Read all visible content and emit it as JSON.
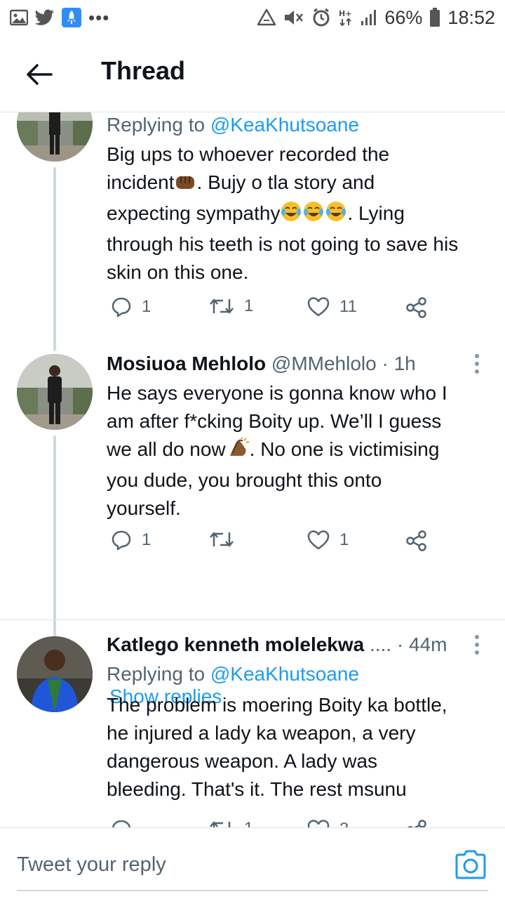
{
  "status_bar": {
    "battery": "66%",
    "time": "18:52",
    "left_icons": [
      "gallery-icon",
      "twitter-bird-icon",
      "rocket-app-icon",
      "more-dots-icon"
    ],
    "right_icons": [
      "recycle-icon",
      "mute-icon",
      "alarm-icon",
      "network-hplus-icon",
      "signal-icon",
      "battery-icon"
    ]
  },
  "header": {
    "title": "Thread",
    "back_icon": "arrow-left-icon"
  },
  "tweets": [
    {
      "replying_prefix": "Replying to ",
      "replying_handle": "@KeaKhutsoane",
      "lines": [
        "Big ups to whoever recorded the",
        "incident",
        ". Bujy o tla story and",
        "expecting sympathy",
        ". Lying",
        "through his teeth is not going to save his",
        "skin on this one."
      ],
      "emojis": [
        "fist-emoji",
        "tears-of-joy-emoji"
      ],
      "replies": "1",
      "retweets": "1",
      "likes": "11"
    },
    {
      "name": "Mosiuoa Mehlolo",
      "handle": "@MMehlolo",
      "time": "· 1h",
      "lines": [
        "He says everyone is gonna know who I",
        "am after f*cking Boity up. We’ll I guess",
        "we all do now",
        ". No one is victimising",
        "you dude, you brought this onto",
        "yourself."
      ],
      "emojis": [
        "clapping-hands-emoji"
      ],
      "replies": "1",
      "retweets": "",
      "likes": "1",
      "show_replies": "Show replies"
    },
    {
      "name": "Katlego kenneth molelekwa",
      "ellipsis": " ....",
      "time": "· 44m",
      "replying_prefix": "Replying to ",
      "replying_handle": "@KeaKhutsoane",
      "lines": [
        "The problem is moering Boity ka bottle,",
        "he injured a lady ka weapon, a very",
        "dangerous weapon. A lady was",
        "bleeding. That's it. The rest msunu"
      ],
      "replies": "",
      "retweets": "1",
      "likes": "3"
    }
  ],
  "composer": {
    "placeholder": "Tweet your reply",
    "camera_icon": "camera-icon"
  },
  "colors": {
    "accent": "#1d9bf0",
    "text_primary": "#0f1419",
    "text_secondary": "#536471",
    "thread_line": "#cfd9de",
    "divider": "#dfe3e6"
  }
}
